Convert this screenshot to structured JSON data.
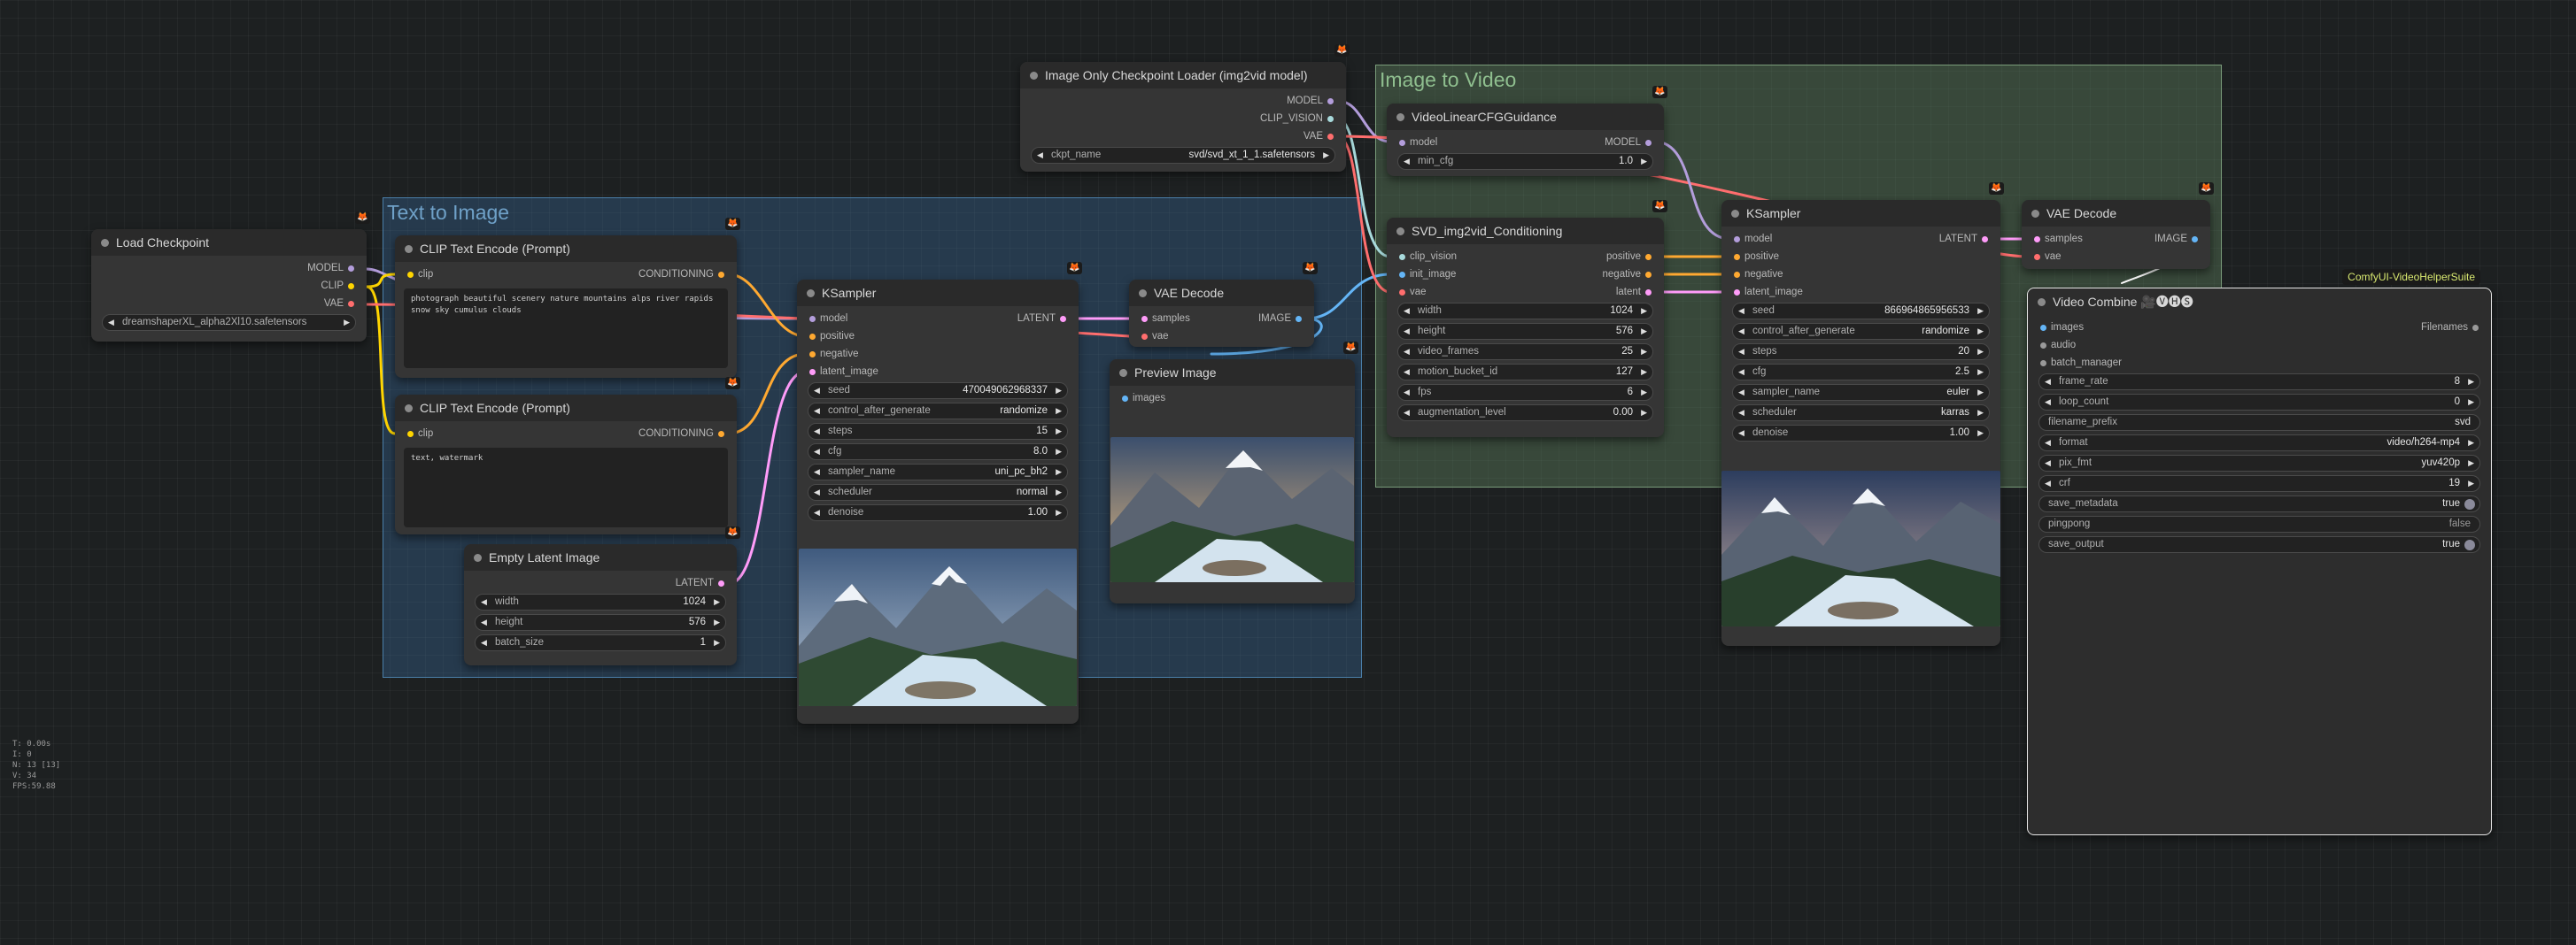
{
  "colors": {
    "model": "#b39ddb",
    "clip": "#ffd500",
    "vae": "#ff6e6e",
    "conditioning": "#ffa931",
    "latent": "#ff9cf9",
    "image": "#64b5f6",
    "clip_vision": "#a8dadc",
    "int": "#8ab4f8"
  },
  "groups": {
    "text_to_image": "Text to Image",
    "image_to_video": "Image to Video"
  },
  "stats": {
    "t": "T: 0.00s",
    "i": "I: 0",
    "n": "N: 13 [13]",
    "v": "V: 34",
    "fps": "FPS:59.88"
  },
  "load_checkpoint": {
    "title": "Load Checkpoint",
    "out_model": "MODEL",
    "out_clip": "CLIP",
    "out_vae": "VAE",
    "ckpt_value": "dreamshaperXL_alpha2Xl10.safetensors"
  },
  "clip_pos": {
    "title": "CLIP Text Encode (Prompt)",
    "in_clip": "clip",
    "out": "CONDITIONING",
    "text": "photograph beautiful scenery nature mountains alps river rapids snow sky cumulus clouds"
  },
  "clip_neg": {
    "title": "CLIP Text Encode (Prompt)",
    "in_clip": "clip",
    "out": "CONDITIONING",
    "text": "text, watermark"
  },
  "empty_latent": {
    "title": "Empty Latent Image",
    "out": "LATENT",
    "widgets": [
      {
        "label": "width",
        "value": "1024"
      },
      {
        "label": "height",
        "value": "576"
      },
      {
        "label": "batch_size",
        "value": "1"
      }
    ]
  },
  "ksampler1": {
    "title": "KSampler",
    "in_model": "model",
    "in_positive": "positive",
    "in_negative": "negative",
    "in_latent": "latent_image",
    "out": "LATENT",
    "widgets": [
      {
        "label": "seed",
        "value": "470049062968337"
      },
      {
        "label": "control_after_generate",
        "value": "randomize"
      },
      {
        "label": "steps",
        "value": "15"
      },
      {
        "label": "cfg",
        "value": "8.0"
      },
      {
        "label": "sampler_name",
        "value": "uni_pc_bh2"
      },
      {
        "label": "scheduler",
        "value": "normal"
      },
      {
        "label": "denoise",
        "value": "1.00"
      }
    ]
  },
  "vae_decode1": {
    "title": "VAE Decode",
    "in_samples": "samples",
    "in_vae": "vae",
    "out": "IMAGE"
  },
  "preview": {
    "title": "Preview Image",
    "in_images": "images"
  },
  "img_ckpt": {
    "title": "Image Only Checkpoint Loader (img2vid model)",
    "out_model": "MODEL",
    "out_clipv": "CLIP_VISION",
    "out_vae": "VAE",
    "ckpt_label": "ckpt_name",
    "ckpt_value": "svd/svd_xt_1_1.safetensors"
  },
  "cfg_guid": {
    "title": "VideoLinearCFGGuidance",
    "in_model": "model",
    "out": "MODEL",
    "widgets": [
      {
        "label": "min_cfg",
        "value": "1.0"
      }
    ]
  },
  "svd_cond": {
    "title": "SVD_img2vid_Conditioning",
    "in_clipv": "clip_vision",
    "in_init": "init_image",
    "in_vae": "vae",
    "out_pos": "positive",
    "out_neg": "negative",
    "out_lat": "latent",
    "widgets": [
      {
        "label": "width",
        "value": "1024"
      },
      {
        "label": "height",
        "value": "576"
      },
      {
        "label": "video_frames",
        "value": "25"
      },
      {
        "label": "motion_bucket_id",
        "value": "127"
      },
      {
        "label": "fps",
        "value": "6"
      },
      {
        "label": "augmentation_level",
        "value": "0.00"
      }
    ]
  },
  "ksampler2": {
    "title": "KSampler",
    "in_model": "model",
    "in_positive": "positive",
    "in_negative": "negative",
    "in_latent": "latent_image",
    "out": "LATENT",
    "widgets": [
      {
        "label": "seed",
        "value": "866964865956533"
      },
      {
        "label": "control_after_generate",
        "value": "randomize"
      },
      {
        "label": "steps",
        "value": "20"
      },
      {
        "label": "cfg",
        "value": "2.5"
      },
      {
        "label": "sampler_name",
        "value": "euler"
      },
      {
        "label": "scheduler",
        "value": "karras"
      },
      {
        "label": "denoise",
        "value": "1.00"
      }
    ]
  },
  "vae_decode2": {
    "title": "VAE Decode",
    "in_samples": "samples",
    "in_vae": "vae",
    "out": "IMAGE"
  },
  "video_combine": {
    "title": "Video Combine",
    "title_icons": "🎥🅥🅗🅢",
    "suite": "ComfyUI-VideoHelperSuite",
    "in_images": "images",
    "in_audio": "audio",
    "in_batch": "batch_manager",
    "out": "Filenames",
    "widgets": [
      {
        "label": "frame_rate",
        "value": "8"
      },
      {
        "label": "loop_count",
        "value": "0"
      },
      {
        "label": "filename_prefix",
        "value": "svd"
      },
      {
        "label": "format",
        "value": "video/h264-mp4"
      },
      {
        "label": "pix_fmt",
        "value": "yuv420p"
      },
      {
        "label": "crf",
        "value": "19"
      },
      {
        "label": "save_metadata",
        "value": "true"
      },
      {
        "label": "pingpong",
        "value": "false"
      },
      {
        "label": "save_output",
        "value": "true"
      }
    ]
  }
}
